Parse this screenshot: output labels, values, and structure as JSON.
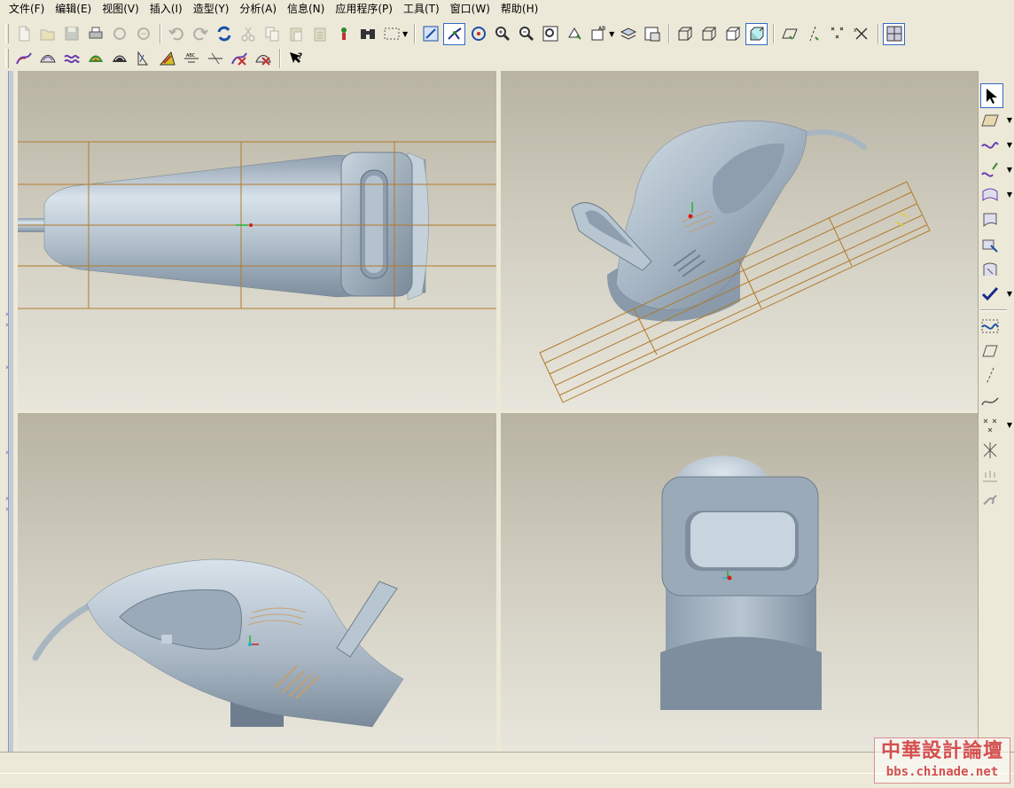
{
  "menu": {
    "items": [
      "文件(F)",
      "编辑(E)",
      "视图(V)",
      "插入(I)",
      "造型(Y)",
      "分析(A)",
      "信息(N)",
      "应用程序(P)",
      "工具(T)",
      "窗口(W)",
      "帮助(H)"
    ]
  },
  "toolbar1": {
    "icons": [
      "new-file-icon",
      "open-file-icon",
      "save-icon",
      "print-icon",
      "send-mail-icon",
      "mail-icon",
      "undo-icon",
      "redo-icon",
      "regenerate-icon",
      "cut-icon",
      "copy-icon",
      "paste-icon",
      "paste-special-icon",
      "model-tree-icon",
      "find-icon",
      "select-box-icon",
      "sketch-view-icon",
      "datum-point-display-icon",
      "spin-center-icon",
      "zoom-in-icon",
      "zoom-out-icon",
      "refit-icon",
      "reorient-icon",
      "saved-views-icon",
      "layers-icon",
      "view-manager-icon",
      "wireframe-icon",
      "hidden-line-icon",
      "no-hidden-icon",
      "shading-icon",
      "datum-planes-icon",
      "datum-axes-icon",
      "datum-points-icon",
      "coordinate-systems-icon",
      "window-layout-icon"
    ]
  },
  "toolbar2": {
    "icons": [
      "curve-analysis-icon",
      "surface-analysis-icon",
      "curvature-icon",
      "shaded-curvature-icon",
      "reflection-icon",
      "draft-icon",
      "slope-icon",
      "dihedral-icon",
      "deviation-icon",
      "delete-analysis-icon",
      "delete-all-analysis-icon",
      "whats-this-icon"
    ]
  },
  "right_toolbar": {
    "icons": [
      "select-arrow-icon",
      "sketch-plane-icon",
      "curve-icon",
      "curve-from-plane-icon",
      "boundary-surface-icon",
      "draft-surface-icon",
      "surface-edit-icon",
      "surface-connect-icon",
      "done-check-icon",
      "style-curve-icon",
      "datum-plane-icon",
      "datum-axis-icon",
      "sketch-curve-icon",
      "datum-point-icon",
      "datum-csys-icon",
      "offset-point-icon",
      "chain-link-icon"
    ]
  },
  "viewports": [
    "top-view",
    "trimetric-view",
    "side-view",
    "front-view"
  ],
  "watermark": {
    "title": "中華設計論壇",
    "url": "bbs.chinade.net"
  },
  "colors": {
    "model": "#aab8c6",
    "datum_plane": "#b8862e",
    "background_top": "#b8b3a2",
    "background_bottom": "#e8e6dc"
  }
}
